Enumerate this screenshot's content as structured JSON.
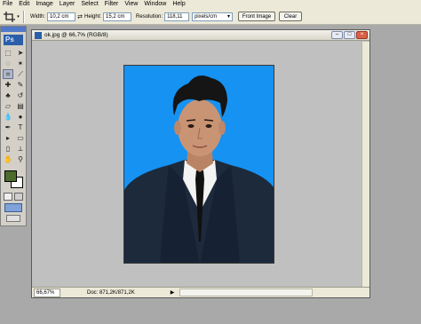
{
  "menu": [
    "File",
    "Edit",
    "Image",
    "Layer",
    "Select",
    "Filter",
    "View",
    "Window",
    "Help"
  ],
  "options": {
    "width_label": "Width:",
    "width_value": "10,2 cm",
    "height_label": "Height:",
    "height_value": "15,2 cm",
    "resolution_label": "Resolution:",
    "resolution_value": "118,11",
    "units_value": "pixels/cm",
    "front_image_label": "Front Image",
    "clear_label": "Clear"
  },
  "toolbox": {
    "logo": "Ps",
    "foreground_color": "#4d6b2c",
    "background_color": "#ffffff"
  },
  "document": {
    "title": "ok.jpg @ 66,7% (RGB/8)",
    "background_color": "#1692f2",
    "zoom": "66,67%",
    "doc_info": "Doc: 871,2K/871,2K"
  }
}
